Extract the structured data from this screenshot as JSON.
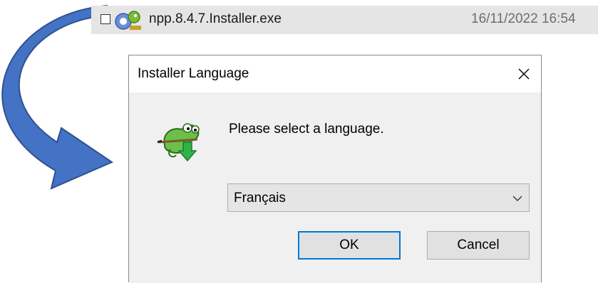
{
  "file_row": {
    "name": "npp.8.4.7.Installer.exe",
    "modified": "16/11/2022 16:54",
    "icon": "notepadpp-installer-icon"
  },
  "dialog": {
    "title": "Installer Language",
    "close_glyph": "×",
    "prompt": "Please select a language.",
    "selected_language": "Français",
    "ok_label": "OK",
    "cancel_label": "Cancel",
    "icon": "notepadpp-chameleon-icon"
  },
  "colors": {
    "arrow_fill": "#4472c4",
    "arrow_stroke": "#2f528f",
    "focus_border": "#0078d7",
    "dialog_body": "#f0f0f0",
    "file_row_highlight": "#e5e5e5"
  }
}
